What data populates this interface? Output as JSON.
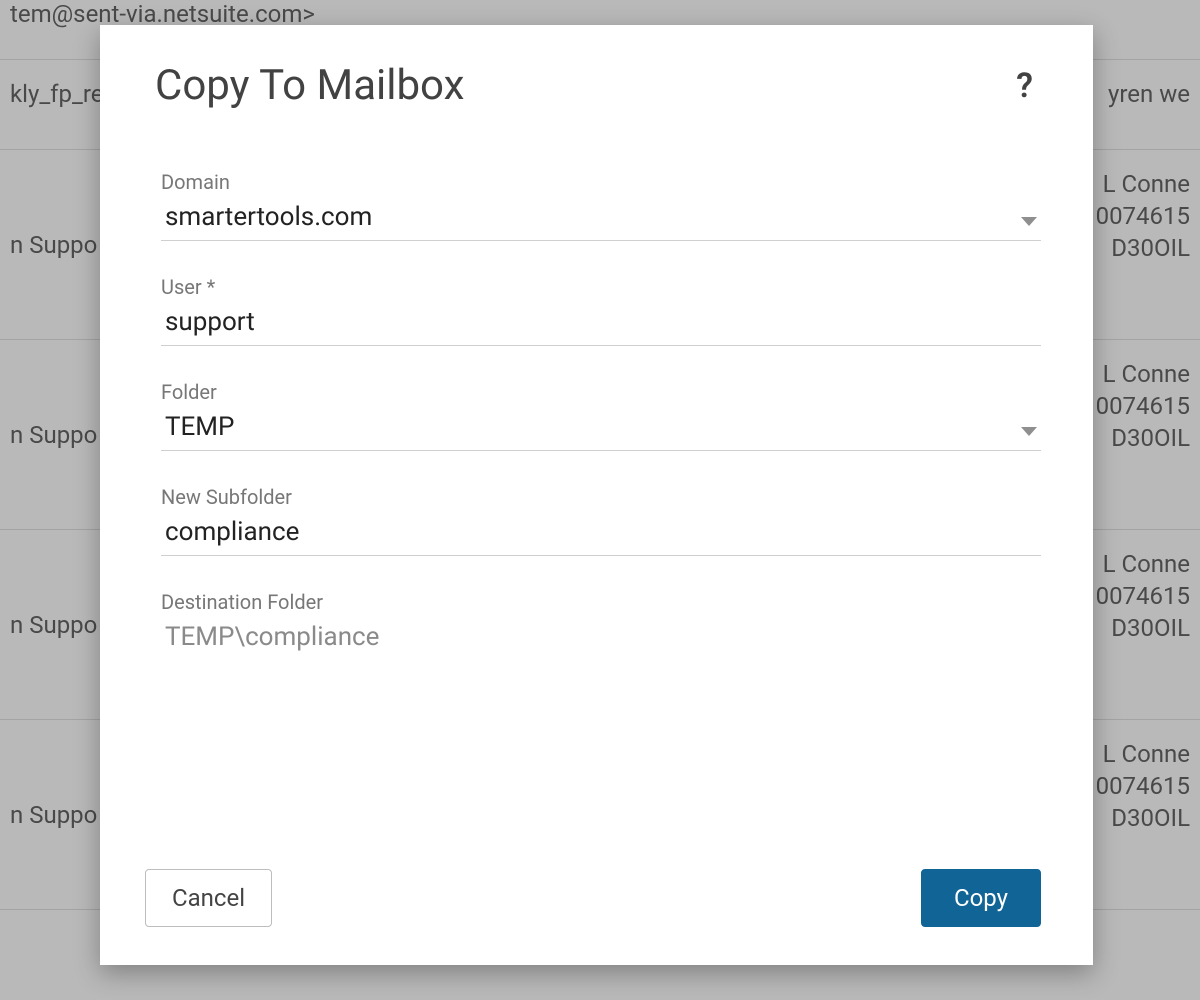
{
  "modal": {
    "title": "Copy To Mailbox",
    "help_label": "?",
    "fields": {
      "domain_label": "Domain",
      "domain_value": "smartertools.com",
      "user_label": "User *",
      "user_value": "support",
      "folder_label": "Folder",
      "folder_value": "TEMP",
      "subfolder_label": "New Subfolder",
      "subfolder_value": "compliance",
      "destination_label": "Destination Folder",
      "destination_value": "TEMP\\compliance"
    },
    "buttons": {
      "cancel": "Cancel",
      "copy": "Copy"
    }
  },
  "background": {
    "row0_left": "tem@sent-via.netsuite.com>",
    "row1_left": "kly_fp_re",
    "row1_right": "yren we",
    "support_left": "n Suppo",
    "right_line1": "L Conne",
    "right_line2": "0074615",
    "right_line3": "D30OIL"
  }
}
